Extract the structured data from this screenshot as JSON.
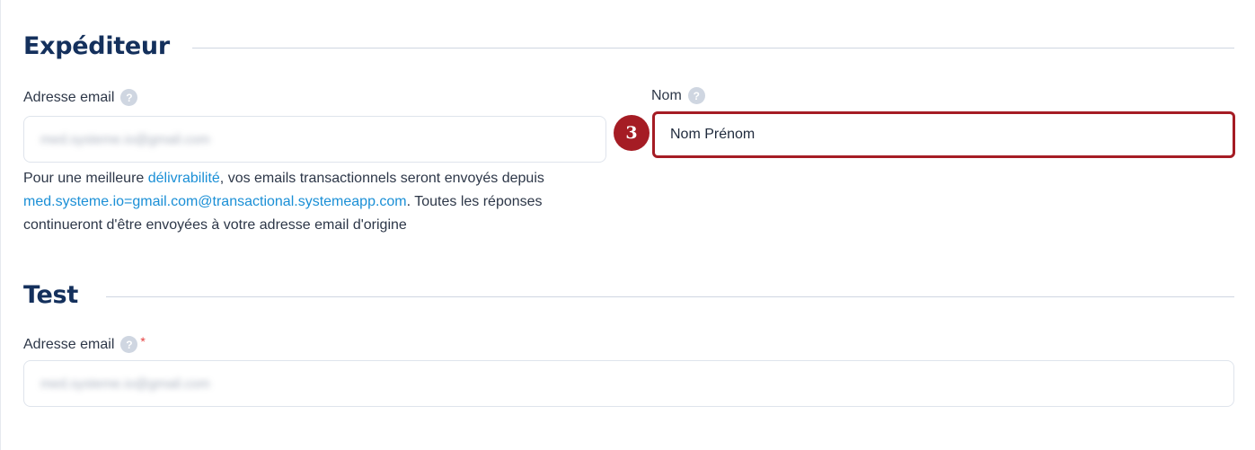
{
  "sender_section": {
    "title": "Expéditeur",
    "email_field": {
      "label": "Adresse email",
      "help_icon": "question-circle-icon",
      "value": "med.systeme.io@gmail.com"
    },
    "name_field": {
      "label": "Nom",
      "help_icon": "question-circle-icon",
      "value": "Nom Prénom",
      "step_badge": "3"
    },
    "deliverability_note": {
      "part1": "Pour une meilleure ",
      "link1": "délivrabilité",
      "part2": ", vos emails transactionnels seront envoyés depuis ",
      "link2": "med.systeme.io=gmail.com@transactional.systemeapp.com",
      "part3": ". Toutes les réponses continueront d'être envoyées à votre adresse email d'origine"
    }
  },
  "test_section": {
    "title": "Test",
    "email_field": {
      "label": "Adresse email",
      "help_icon": "question-circle-icon",
      "required_marker": "*",
      "value": "med.systeme.io@gmail.com"
    }
  },
  "colors": {
    "heading": "#14305c",
    "link": "#1a8fd6",
    "highlight": "#a51c24",
    "required": "#e53e3e"
  }
}
